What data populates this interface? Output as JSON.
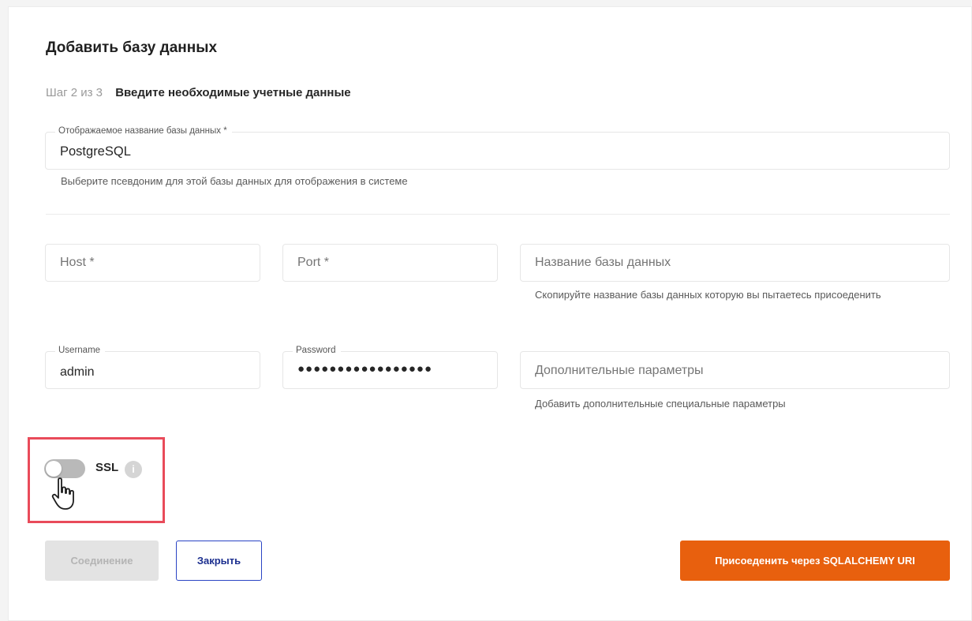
{
  "dialog": {
    "title": "Добавить базу данных",
    "step_count": "Шаг 2 из 3",
    "step_desc": "Введите необходимые учетные данные"
  },
  "display_name": {
    "label": "Отображаемое название базы данных *",
    "value": "PostgreSQL",
    "helper": "Выберите псевдоним для этой базы данных для отображения в системе"
  },
  "host": {
    "placeholder": "Host *"
  },
  "port": {
    "placeholder": "Port *"
  },
  "database_name": {
    "placeholder": "Название базы данных",
    "helper": "Скопируйте название базы данных которую вы пытаетесь присоеденить"
  },
  "username": {
    "label": "Username",
    "value": "admin"
  },
  "password": {
    "label": "Password",
    "value": "●●●●●●●●●●●●●●●●●"
  },
  "extra_params": {
    "placeholder": "Дополнительные параметры",
    "helper": "Добавить дополнительные специальные параметры"
  },
  "ssl": {
    "label": "SSL",
    "enabled": false,
    "info_glyph": "i"
  },
  "buttons": {
    "connect": "Соединение",
    "close": "Закрыть",
    "sqlalchemy": "Присоеденить через SQLALCHEMY URI"
  },
  "colors": {
    "accent": "#e8600e",
    "close_border": "#2a44c4",
    "highlight": "#e94b5a",
    "toggle_off": "#b9b9b9"
  },
  "icons": {
    "info": "info-icon",
    "cursor": "hand-pointer-icon"
  }
}
